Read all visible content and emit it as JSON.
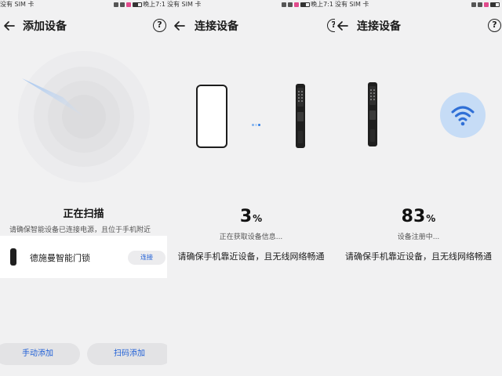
{
  "statusbar": {
    "panel1": {
      "left": "没有 SIM 卡",
      "right": "晚上7:1"
    },
    "panel2": {
      "left": "没有 SIM 卡",
      "right": "晚上7:1"
    },
    "panel3": {
      "left": "没有 SIM 卡",
      "right": ""
    }
  },
  "add_screen": {
    "title": "添加设备",
    "help": "?",
    "scan_title": "正在扫描",
    "scan_subtitle": "请确保智能设备已连接电源，且位于手机附近",
    "device": {
      "name": "德施曼智能门锁",
      "connect_label": "连接"
    },
    "manual_add_label": "手动添加",
    "qr_add_label": "扫码添加"
  },
  "connect_screen_1": {
    "title": "连接设备",
    "help": "?",
    "progress_value": "3",
    "progress_unit": "%",
    "status": "正在获取设备信息...",
    "hint": "请确保手机靠近设备，且无线网络畅通"
  },
  "connect_screen_2": {
    "title": "连接设备",
    "help": "?",
    "progress_value": "83",
    "progress_unit": "%",
    "status": "设备注册中...",
    "hint": "请确保手机靠近设备，且无线网络畅通"
  },
  "icons": {
    "back": "arrow-left-icon",
    "help": "question-circle-icon",
    "wifi": "wifi-icon",
    "lock": "smart-lock-icon",
    "phone": "phone-icon"
  },
  "colors": {
    "accent": "#1f5fd6",
    "background": "#f1f1f2",
    "wifi_badge": "#c6dcf6",
    "wifi_glyph": "#2f6fd6"
  }
}
